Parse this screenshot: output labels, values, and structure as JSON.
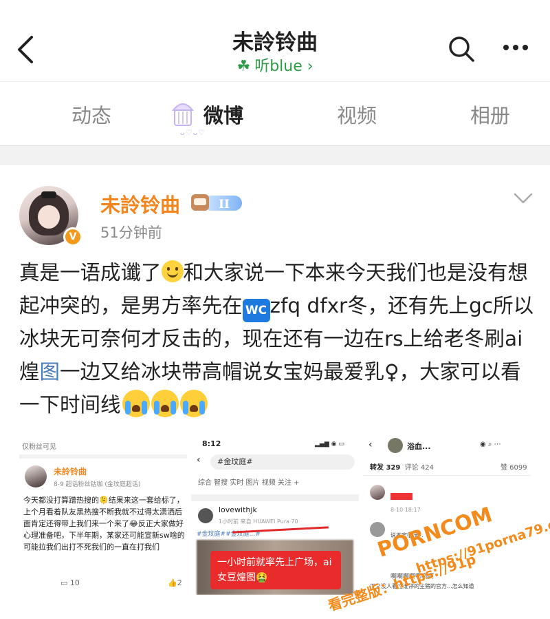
{
  "header": {
    "title": "未詅铃曲",
    "subtitle": "听blue",
    "subtitle_icon": "clover-icon",
    "accent": "#2e9b46"
  },
  "tabs": [
    {
      "label": "动态",
      "active": false
    },
    {
      "label": "微博",
      "active": true
    },
    {
      "label": "视频",
      "active": false
    },
    {
      "label": "相册",
      "active": false
    }
  ],
  "tab_decoration": "ᴗ♡ᴗ♡",
  "post": {
    "author": "未詅铃曲",
    "level": "II",
    "verified": "V",
    "time": "51分钟前",
    "content_1": "真是一语成谶了",
    "content_2": "和大家说一下本来今天我们也是没有想起冲突的，是男方率先在",
    "wc_label": "WC",
    "content_3": "zfq dfxr冬，还有先上gc所以冰块无可奈何才反击的，现在还有一边在rs上给老冬刷ai煌",
    "content_link": "图",
    "content_4": "一边又给冰块带高帽说女宝妈最爱乳♀，大家可以看一下时间线",
    "author_color": "#f1851e",
    "link_color": "#4a7bbb"
  },
  "thumb1": {
    "visibility": "仅粉丝可见",
    "name": "未詅铃曲",
    "meta": "8-9  超话粉丝钴咖 (金玟庭超话)",
    "text": "今天都没打算蹭热搜的🫠结果来这一套给标了，上个月看着队友黑热搜不断我就不过得太潇洒后面肯定还得带上我们来一个来了😂反正大家做好心理准备吧，下半年期，某家还可能宣新sw啥的可能拉我们出打不死我们的一直在打我们",
    "comments": "10",
    "likes": "2"
  },
  "thumb2": {
    "status_time": "8:12",
    "search": "#金玟庭#",
    "tabs": "综合  智搜  实时  图片  视频  关注 +",
    "active_tab": "实时",
    "user": "lovewithjk",
    "meta": "1小时前  来自 HUAWEI Pura 70",
    "tags": "#金玟庭##金玟庭...#",
    "callout": "一小时前就率先上广场，ai女豆煌图🤮"
  },
  "thumb3": {
    "name": "浴血...",
    "tab_repost": "转发 329",
    "tab_comment": "评论 424",
    "likes": "赞 6099",
    "timestamp": "8-10 18:17",
    "comment_2": "说不定很难...",
    "comment_3": "啊啊啊啊啊啊啊",
    "comment_3b": "下又没人看过谁停的生猪的官方...怎么知道"
  },
  "watermark": {
    "line1": "PORNCOM",
    "line2": "https://91porna79.com",
    "line3": "看完整版：https://91p"
  }
}
